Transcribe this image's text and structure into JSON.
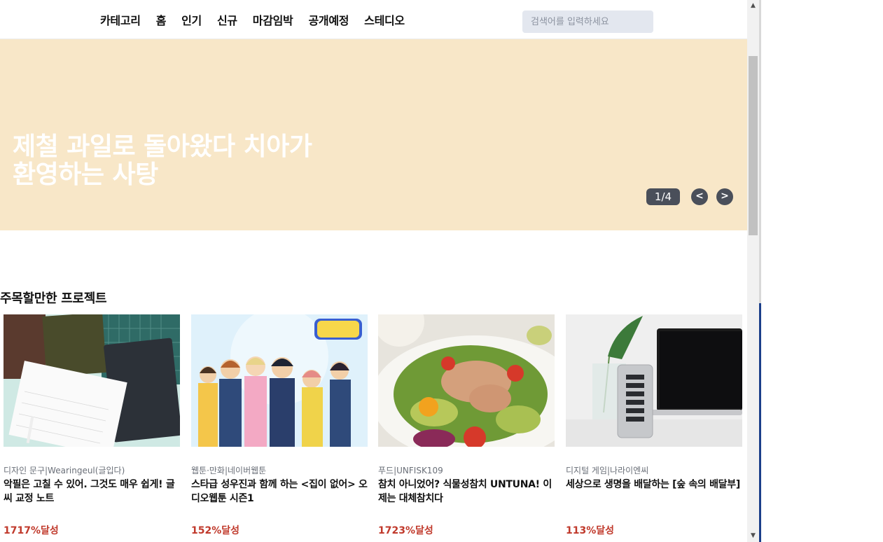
{
  "nav": {
    "items": [
      "카테고리",
      "홈",
      "인기",
      "신규",
      "마감임박",
      "공개예정",
      "스테디오"
    ],
    "search_placeholder": "검색어를 입력하세요"
  },
  "banner": {
    "title_line1": "제철 과일로 돌아왔다 치아가",
    "title_line2": "환영하는 사탕",
    "pager": "1/4",
    "prev": "<",
    "next": ">",
    "background": "#f8e7c8"
  },
  "section": {
    "title": "주목할만한 프로젝트"
  },
  "cards": [
    {
      "category": "디자인 문구|Wearingeul(글입다)",
      "title": "악필은 고칠 수 있어. 그것도 매우 쉽게! 글씨 교정 노트",
      "rate": "1717%달성",
      "image": "notebooks-image"
    },
    {
      "category": "웹툰·만화|네이버웹툰",
      "title": "스타급 성우진과 함께 하는 <집이 없어> 오디오웹툰 시즌1",
      "rate": "152%달성",
      "image": "webtoon-characters-image"
    },
    {
      "category": "푸드|UNFISK109",
      "title": "참치 아니었어? 식물성참치 UNTUNA! 이제는 대체참치다",
      "rate": "1723%달성",
      "image": "salad-image"
    },
    {
      "category": "디지털 게임|나라이엔씨",
      "title": "세상으로 생명을 배달하는 [숲 속의 배달부]",
      "rate": "113%달성",
      "image": "laptop-device-image"
    }
  ],
  "colors": {
    "accent_rate": "#c0392b",
    "pager_bg": "#4a4f5a",
    "search_bg": "#e3e7ef"
  }
}
